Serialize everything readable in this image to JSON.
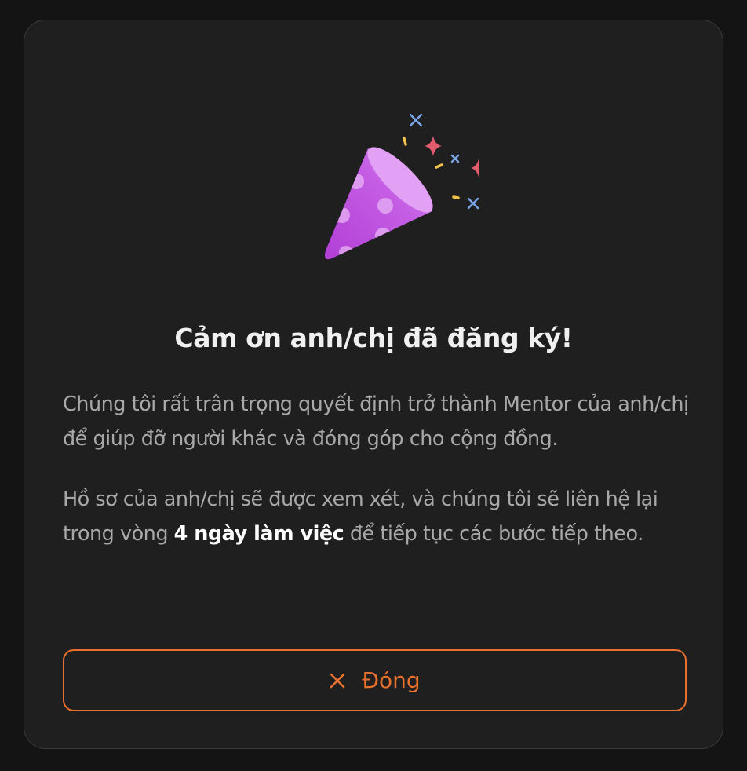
{
  "dialog": {
    "title": "Cảm ơn anh/chị đã đăng ký!",
    "paragraph1": "Chúng tôi rất trân trọng quyết định trở thành Mentor của anh/chị để giúp đỡ người khác và đóng góp cho cộng đồng.",
    "paragraph2_before": "Hồ sơ của anh/chị sẽ được xem xét, và chúng tôi sẽ liên hệ lại trong vòng ",
    "paragraph2_bold": "4 ngày làm việc",
    "paragraph2_after": " để tiếp tục các bước tiếp theo.",
    "close_label": "Đóng",
    "illustration_icon": "party-popper-icon",
    "close_icon": "close-icon"
  },
  "colors": {
    "accent": "#e8702f",
    "background": "#141414",
    "card": "#1f1f1f",
    "title": "#f0f0f0",
    "body_text": "#a8a8a8"
  }
}
